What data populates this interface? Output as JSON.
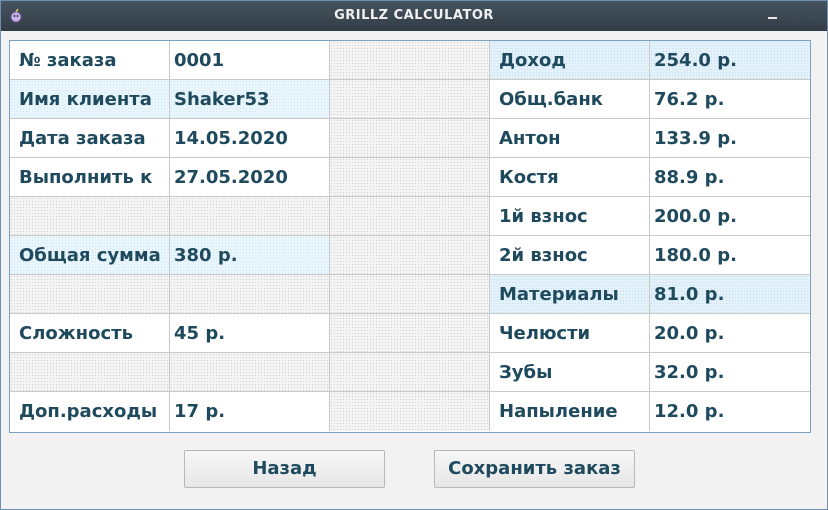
{
  "window": {
    "title": "GRILLZ CALCULATOR"
  },
  "left_rows": [
    {
      "label": "№ заказа",
      "value": "0001"
    },
    {
      "label": "Имя клиента",
      "value": "Shaker53"
    },
    {
      "label": "Дата заказа",
      "value": "14.05.2020"
    },
    {
      "label": "Выполнить к",
      "value": "27.05.2020"
    },
    {
      "label": "",
      "value": ""
    },
    {
      "label": "Общая сумма",
      "value": "380 р."
    },
    {
      "label": "",
      "value": ""
    },
    {
      "label": "Сложность",
      "value": "45 р."
    },
    {
      "label": "",
      "value": ""
    },
    {
      "label": "Доп.расходы",
      "value": "17 р."
    }
  ],
  "right_rows": [
    {
      "label": "Доход",
      "value": "254.0 р."
    },
    {
      "label": "Общ.банк",
      "value": "76.2 р."
    },
    {
      "label": "Антон",
      "value": "133.9 р."
    },
    {
      "label": "Костя",
      "value": "88.9 р."
    },
    {
      "label": "1й взнос",
      "value": "200.0 р."
    },
    {
      "label": "2й взнос",
      "value": "180.0 р."
    },
    {
      "label": "Материалы",
      "value": "81.0 р."
    },
    {
      "label": "Челюсти",
      "value": "20.0 р."
    },
    {
      "label": "Зубы",
      "value": "32.0 р."
    },
    {
      "label": "Напыление",
      "value": "12.0 р."
    }
  ],
  "buttons": {
    "back": "Назад",
    "save": "Сохранить заказ"
  },
  "colors": {
    "text": "#1f4a5e",
    "titlebar": "#3a4650",
    "grid_border": "#7aa2c4",
    "highlight": "#e9f5fc"
  }
}
